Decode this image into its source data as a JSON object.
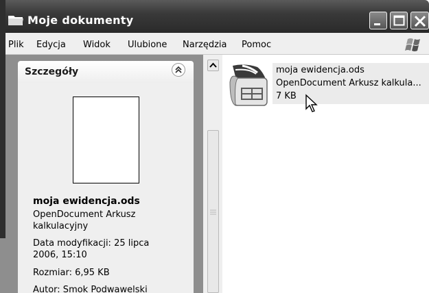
{
  "window": {
    "title": "Moje dokumenty"
  },
  "menubar": {
    "items": [
      "Plik",
      "Edycja",
      "Widok",
      "Ulubione",
      "Narzędzia",
      "Pomoc"
    ]
  },
  "details_pane": {
    "title": "Szczegóły",
    "file_name": "moja ewidencja.ods",
    "file_type_line1": "OpenDocument Arkusz",
    "file_type_line2": "kalkulacyjny",
    "modified_line1": "Data modyfikacji: 25 lipca",
    "modified_line2": "2006, 15:10",
    "size": "Rozmiar: 6,95 KB",
    "author": "Autor: Smok Podwawelski"
  },
  "file_item": {
    "name": "moja ewidencja.ods",
    "type": "OpenDocument Arkusz kalkula...",
    "size": "7 KB"
  },
  "icons": [
    "folder-icon",
    "minimize-icon",
    "maximize-icon",
    "close-icon",
    "windows-logo-icon",
    "collapse-icon",
    "spreadsheet-file-icon",
    "mouse-cursor-icon"
  ]
}
